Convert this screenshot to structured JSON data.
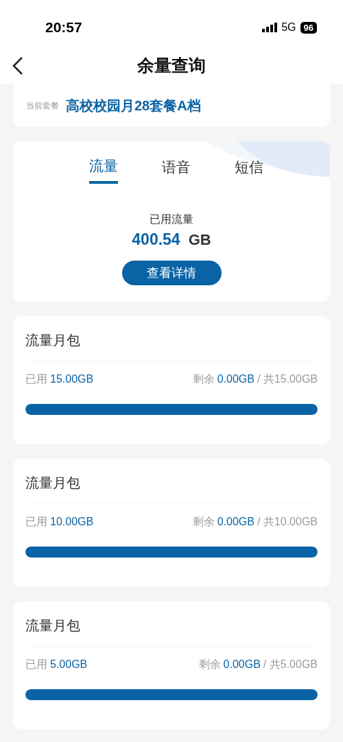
{
  "status_bar": {
    "time": "20:57",
    "network": "5G",
    "battery": "96"
  },
  "header": {
    "title": "余量查询"
  },
  "plan": {
    "label": "当前套餐",
    "name": "高校校园月28套餐A档"
  },
  "tabs": [
    {
      "label": "流量",
      "selected": true
    },
    {
      "label": "语音",
      "selected": false
    },
    {
      "label": "短信",
      "selected": false
    }
  ],
  "usage": {
    "label": "已用流量",
    "value": "400.54",
    "unit": "GB",
    "button": "查看详情"
  },
  "packages": [
    {
      "title": "流量月包",
      "used_label": "已用",
      "used": "15.00GB",
      "remain_label": "剩余",
      "remain": "0.00GB",
      "total": "/ 共15.00GB",
      "level": 1
    },
    {
      "title": "流量月包",
      "used_label": "已用",
      "used": "10.00GB",
      "remain_label": "剩余",
      "remain": "0.00GB",
      "total": "/ 共10.00GB",
      "level": 1
    },
    {
      "title": "流量月包",
      "used_label": "已用",
      "used": "5.00GB",
      "remain_label": "剩余",
      "remain": "0.00GB",
      "total": "/ 共5.00GB",
      "level": 1
    }
  ]
}
